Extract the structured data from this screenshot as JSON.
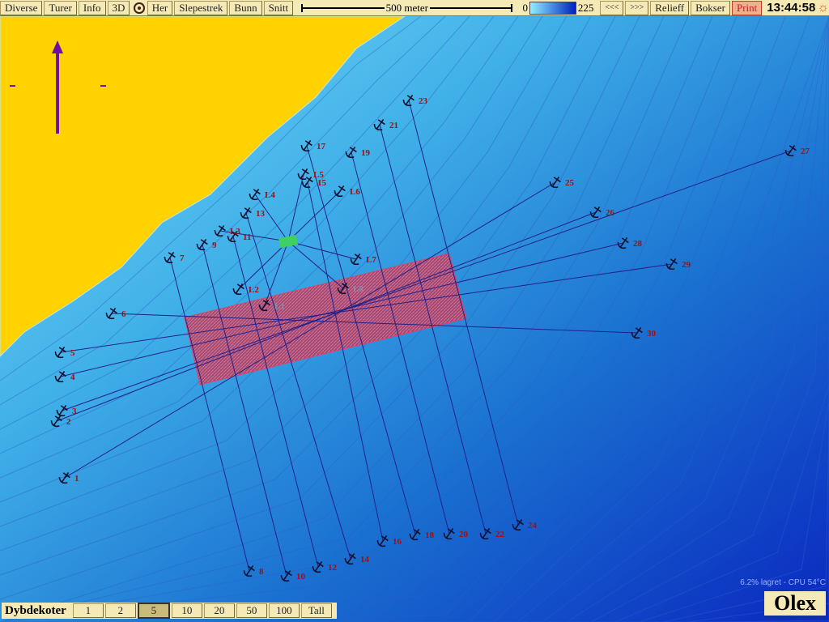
{
  "toolbar": {
    "buttons": [
      "Diverse",
      "Turer",
      "Info",
      "3D",
      "Her",
      "Slepestrek",
      "Bunn",
      "Snitt"
    ],
    "scale_label": "500 meter",
    "depth_min": "0",
    "depth_max": "225",
    "right_buttons": [
      "<<<",
      ">>>",
      "Relieff",
      "Bokser"
    ],
    "print": "Print",
    "clock": "13:44:58"
  },
  "map": {
    "anchor_labels": [
      "1",
      "2",
      "3",
      "4",
      "5",
      "6",
      "7",
      "8",
      "9",
      "10",
      "11",
      "12",
      "13",
      "14",
      "15",
      "16",
      "17",
      "18",
      "19",
      "20",
      "21",
      "22",
      "23",
      "24",
      "25",
      "26",
      "27",
      "28",
      "29",
      "30",
      "L1",
      "L2",
      "L3",
      "L4",
      "L5",
      "L6",
      "L7",
      "L8"
    ],
    "colors": {
      "land": "#ffd200",
      "box": "#c03050",
      "center": "#40d060",
      "track": "#20208a",
      "label": "#a01010"
    }
  },
  "bottombar": {
    "title": "Dybdekoter",
    "options": [
      "1",
      "2",
      "5",
      "10",
      "20",
      "50",
      "100",
      "Tall"
    ],
    "selected": "5"
  },
  "status": "6.2% lagret - CPU 54°C",
  "logo": "Olex"
}
